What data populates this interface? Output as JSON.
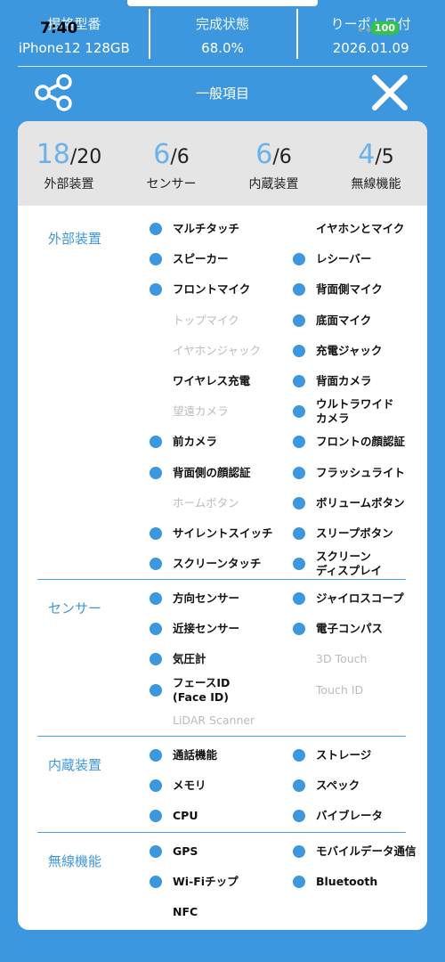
{
  "status": {
    "time": "7:40",
    "battery": "100"
  },
  "summary": [
    {
      "label": "掲格型番",
      "value": "iPhone12 128GB"
    },
    {
      "label": "完成状態",
      "value": "68.0%"
    },
    {
      "label": "りーポト日付",
      "value": "2026.01.09"
    }
  ],
  "header": {
    "title": "一般項目"
  },
  "counts": [
    {
      "n": "18",
      "d": "/20",
      "label": "外部装置"
    },
    {
      "n": "6",
      "d": "/6",
      "label": "センサー"
    },
    {
      "n": "6",
      "d": "/6",
      "label": "内蔵装置"
    },
    {
      "n": "4",
      "d": "/5",
      "label": "無線機能"
    }
  ],
  "sections": {
    "external": {
      "label": "外部装置",
      "col1": [
        {
          "label": "マルチタッチ",
          "on": true
        },
        {
          "label": "スピーカー",
          "on": true
        },
        {
          "label": "フロントマイク",
          "on": true
        },
        {
          "label": "トップマイク",
          "on": false
        },
        {
          "label": "イヤホンジャック",
          "on": false
        },
        {
          "label": "ワイヤレス充電",
          "on": false,
          "bold": true
        },
        {
          "label": "望遠カメラ",
          "on": false
        },
        {
          "label": "前カメラ",
          "on": true
        },
        {
          "label": "背面側の顔認証",
          "on": true
        },
        {
          "label": "ホームボタン",
          "on": false
        },
        {
          "label": "サイレントスイッチ",
          "on": true
        },
        {
          "label": "スクリーンタッチ",
          "on": true
        }
      ],
      "col2": [
        {
          "label": "イヤホンとマイク",
          "on": false,
          "bold": true
        },
        {
          "label": "レシーバー",
          "on": true
        },
        {
          "label": "背面側マイク",
          "on": true
        },
        {
          "label": "底面マイク",
          "on": true
        },
        {
          "label": "充電ジャック",
          "on": true
        },
        {
          "label": "背面カメラ",
          "on": true
        },
        {
          "label": "ウルトラワイド\nカメラ",
          "on": true
        },
        {
          "label": "フロントの顔認証",
          "on": true
        },
        {
          "label": "フラッシュライト",
          "on": true
        },
        {
          "label": "ボリュームボタン",
          "on": true
        },
        {
          "label": "スリープボタン",
          "on": true
        },
        {
          "label": "スクリーン\nディスプレイ",
          "on": true
        }
      ]
    },
    "sensor": {
      "label": "センサー",
      "col1": [
        {
          "label": "方向センサー",
          "on": true
        },
        {
          "label": "近接センサー",
          "on": true
        },
        {
          "label": "気圧計",
          "on": true
        },
        {
          "label": "フェースID\n(Face ID)",
          "on": true
        },
        {
          "label": "LiDAR Scanner",
          "on": false
        }
      ],
      "col2": [
        {
          "label": "ジャイロスコープ",
          "on": true
        },
        {
          "label": "電子コンパス",
          "on": true
        },
        {
          "label": "3D Touch",
          "on": false,
          "nodot": true
        },
        {
          "label": "Touch ID",
          "on": false,
          "nodot": true
        }
      ]
    },
    "internal": {
      "label": "内蔵装置",
      "col1": [
        {
          "label": "通話機能",
          "on": true
        },
        {
          "label": "メモリ",
          "on": true
        },
        {
          "label": "CPU",
          "on": true
        }
      ],
      "col2": [
        {
          "label": "ストレージ",
          "on": true
        },
        {
          "label": "スペック",
          "on": true
        },
        {
          "label": "バイブレータ",
          "on": true
        }
      ]
    },
    "wireless": {
      "label": "無線機能",
      "col1": [
        {
          "label": "GPS",
          "on": true
        },
        {
          "label": "Wi-Fiチップ",
          "on": true
        },
        {
          "label": "NFC",
          "on": false,
          "bold": true
        }
      ],
      "col2": [
        {
          "label": "モバイルデータ通信",
          "on": true
        },
        {
          "label": "Bluetooth",
          "on": true
        }
      ]
    }
  }
}
